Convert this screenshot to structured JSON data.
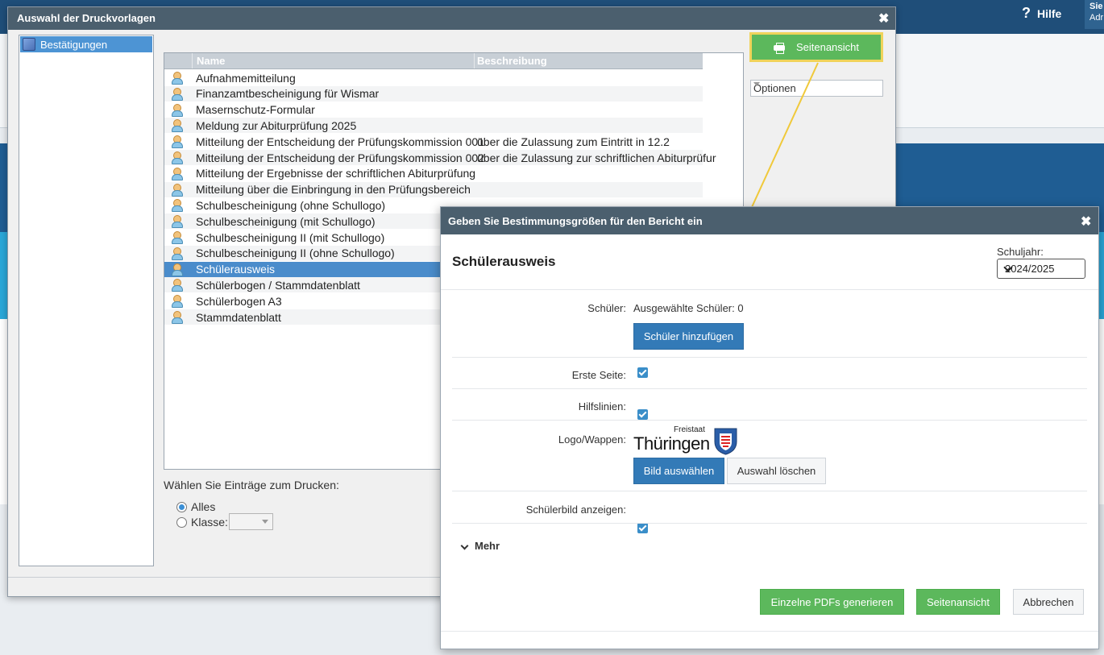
{
  "background": {
    "help_label": "Hilfe",
    "user_top": "Sie",
    "user_bottom": "Adr"
  },
  "print_window": {
    "title": "Auswahl der Druckvorlagen",
    "tree": {
      "items": [
        {
          "label": "Bestätigungen"
        }
      ]
    },
    "list": {
      "columns": {
        "name": "Name",
        "description": "Beschreibung"
      },
      "rows": [
        {
          "name": "Aufnahmemitteilung",
          "description": ""
        },
        {
          "name": "Finanzamtbescheinigung für Wismar",
          "description": ""
        },
        {
          "name": "Masernschutz-Formular",
          "description": ""
        },
        {
          "name": "Meldung zur Abiturprüfung 2025",
          "description": ""
        },
        {
          "name": "Mitteilung der Entscheidung der Prüfungskommission 001",
          "description": "über die Zulassung zum Eintritt in 12.2"
        },
        {
          "name": "Mitteilung der Entscheidung der Prüfungskommission 002",
          "description": "über die Zulassung zur schriftlichen Abiturprüfur"
        },
        {
          "name": "Mitteilung der Ergebnisse der schriftlichen Abiturprüfung",
          "description": ""
        },
        {
          "name": "Mitteilung über die Einbringung in den Prüfungsbereich",
          "description": ""
        },
        {
          "name": "Schulbescheinigung  (ohne Schullogo)",
          "description": ""
        },
        {
          "name": "Schulbescheinigung (mit Schullogo)",
          "description": ""
        },
        {
          "name": "Schulbescheinigung II (mit Schullogo)",
          "description": ""
        },
        {
          "name": "Schulbescheinigung II (ohne Schullogo)",
          "description": ""
        },
        {
          "name": "Schülerausweis",
          "description": ""
        },
        {
          "name": "Schülerbogen / Stammdatenblatt",
          "description": ""
        },
        {
          "name": "Schülerbogen A3",
          "description": ""
        },
        {
          "name": "Stammdatenblatt",
          "description": ""
        }
      ],
      "selected_index": 12
    },
    "preview_button": "Seitenansicht",
    "options_select": "Optionen",
    "print_scope_label": "Wählen Sie Einträge zum Drucken:",
    "radio_all": "Alles",
    "radio_class": "Klasse:"
  },
  "report_dialog": {
    "title": "Geben Sie Bestimmungsgrößen für den Bericht ein",
    "heading": "Schülerausweis",
    "school_year_label": "Schuljahr:",
    "school_year_value": "2024/2025",
    "students_label": "Schüler:",
    "students_value": "Ausgewählte Schüler: 0",
    "add_students_button": "Schüler hinzufügen",
    "first_page_label": "Erste Seite:",
    "guidelines_label": "Hilfslinien:",
    "logo_label": "Logo/Wappen:",
    "logo_text_small": "Freistaat",
    "logo_text_big": "Thüringen",
    "choose_image_button": "Bild auswählen",
    "clear_selection_button": "Auswahl löschen",
    "show_photo_label": "Schülerbild anzeigen:",
    "more_label": "Mehr",
    "generate_pdfs_button": "Einzelne PDFs generieren",
    "preview_button": "Seitenansicht",
    "cancel_button": "Abbrechen"
  },
  "colors": {
    "title_bar": "#4b5f6e",
    "green_button": "#5cb85c",
    "blue_button": "#337ab7",
    "highlight": "#f0d35a",
    "selection": "#4a8ccb"
  }
}
